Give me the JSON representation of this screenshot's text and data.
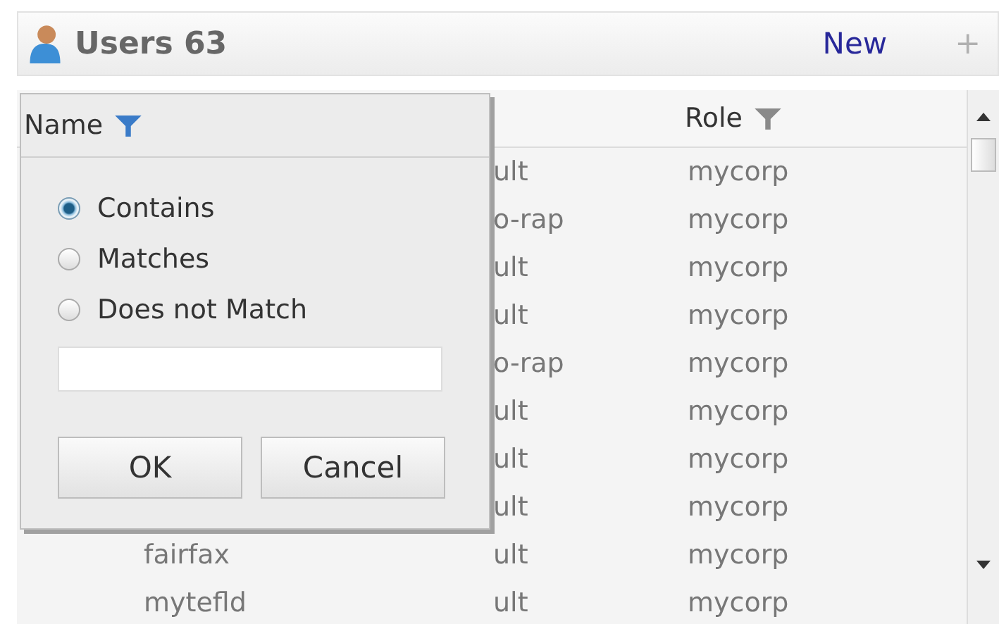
{
  "header": {
    "title": "Users 63",
    "new_link": "New",
    "add_button": "+"
  },
  "grid": {
    "columns": [
      {
        "label": "Role",
        "filter_active": false
      }
    ],
    "rows": [
      {
        "column_2": "ult",
        "role": "mycorp"
      },
      {
        "column_2": "o-rap",
        "role": "mycorp"
      },
      {
        "column_2": "ult",
        "role": "mycorp"
      },
      {
        "column_2": "ult",
        "role": "mycorp"
      },
      {
        "column_2": "o-rap",
        "role": "mycorp"
      },
      {
        "column_2": "ult",
        "role": "mycorp"
      },
      {
        "column_2": "ult",
        "role": "mycorp"
      },
      {
        "column_2": "ult",
        "role": "mycorp"
      },
      {
        "column_1": "fairfax",
        "column_2": "ult",
        "role": "mycorp"
      },
      {
        "column_1": "mytefld",
        "column_2": "ult",
        "role": "mycorp"
      }
    ]
  },
  "filter_popup": {
    "column": "Name",
    "filter_active": true,
    "options": [
      {
        "label": "Contains",
        "selected": true
      },
      {
        "label": "Matches",
        "selected": false
      },
      {
        "label": "Does not Match",
        "selected": false
      }
    ],
    "buttons": [
      "OK",
      "Cancel"
    ]
  }
}
